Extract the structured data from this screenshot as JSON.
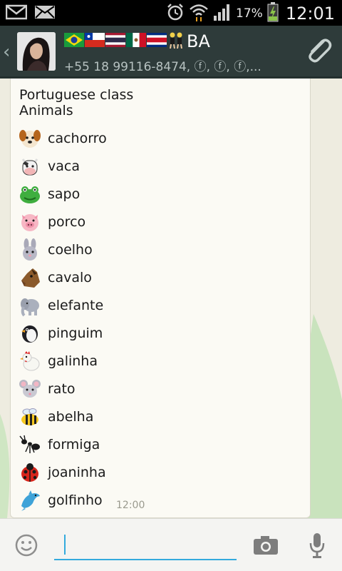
{
  "status_bar": {
    "icons": [
      "gmail-icon",
      "email-icon",
      "alarm-icon",
      "wifi-icon",
      "signal-icon",
      "battery-charging-icon"
    ],
    "battery_percent": "17%",
    "time": "12:01"
  },
  "header": {
    "flags": [
      "brazil-flag-icon",
      "chile-flag-icon",
      "thailand-flag-icon",
      "mexico-flag-icon",
      "costa-rica-flag-icon",
      "dancers-icon"
    ],
    "title": "BA",
    "subtitle": "+55 18 99116-8474, ⓕ, ⓕ, ⓕ,...",
    "attach_icon": "paperclip-icon"
  },
  "message": {
    "heading_line1": "Portuguese class",
    "heading_line2": "Animals",
    "items": [
      {
        "label": "cachorro",
        "icon": "dog-face-icon"
      },
      {
        "label": "vaca",
        "icon": "cow-face-icon"
      },
      {
        "label": "sapo",
        "icon": "frog-face-icon"
      },
      {
        "label": "porco",
        "icon": "pig-face-icon"
      },
      {
        "label": "coelho",
        "icon": "rabbit-face-icon"
      },
      {
        "label": "cavalo",
        "icon": "horse-face-icon"
      },
      {
        "label": "elefante",
        "icon": "elephant-icon"
      },
      {
        "label": "pinguim",
        "icon": "penguin-icon"
      },
      {
        "label": "galinha",
        "icon": "chicken-icon"
      },
      {
        "label": "rato",
        "icon": "mouse-face-icon"
      },
      {
        "label": "abelha",
        "icon": "bee-icon"
      },
      {
        "label": "formiga",
        "icon": "ant-icon"
      },
      {
        "label": "joaninha",
        "icon": "ladybug-icon"
      },
      {
        "label": "golfinho",
        "icon": "dolphin-icon"
      }
    ],
    "time": "12:00"
  },
  "input_bar": {
    "emoji_icon": "smiley-icon",
    "camera_icon": "camera-icon",
    "mic_icon": "microphone-icon",
    "text_value": ""
  },
  "colors": {
    "header_bg": "#2e3b3a",
    "accent": "#33aadd",
    "bubble_bg": "#fbfaf4",
    "wallpaper_shape": "#c9e3bd"
  }
}
